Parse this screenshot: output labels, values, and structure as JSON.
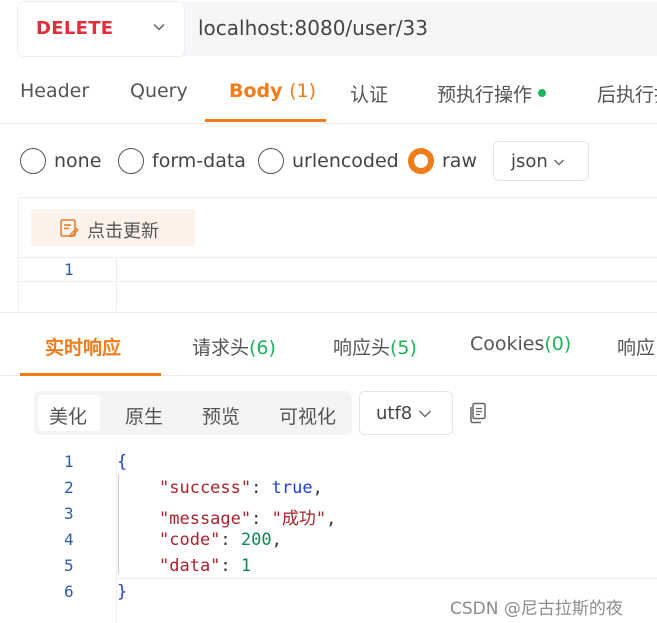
{
  "request": {
    "method": "DELETE",
    "url": "localhost:8080/user/33"
  },
  "request_tabs": [
    {
      "label": "Header",
      "count": ""
    },
    {
      "label": "Query",
      "count": ""
    },
    {
      "label": "Body",
      "count": "(1)"
    },
    {
      "label": "认证",
      "count": ""
    },
    {
      "label": "预执行操作",
      "count": ""
    },
    {
      "label": "后执行操",
      "count": ""
    }
  ],
  "body_types": [
    "none",
    "form-data",
    "urlencoded",
    "raw"
  ],
  "body_type_selected": "raw",
  "body_format": "json",
  "update_button": "点击更新",
  "request_editor": {
    "line_numbers": [
      "1"
    ]
  },
  "response_tabs": [
    {
      "label": "实时响应",
      "count": ""
    },
    {
      "label": "请求头",
      "count": "(6)"
    },
    {
      "label": "响应头",
      "count": "(5)"
    },
    {
      "label": "Cookies",
      "count": "(0)"
    },
    {
      "label": "响应:",
      "count": ""
    }
  ],
  "view_modes": [
    "美化",
    "原生",
    "预览",
    "可视化"
  ],
  "view_mode_selected": "美化",
  "encoding": "utf8",
  "response_body": {
    "line_numbers": [
      "1",
      "2",
      "3",
      "4",
      "5",
      "6"
    ],
    "open_brace": "{",
    "close_brace": "}",
    "fields": [
      {
        "key": "\"success\"",
        "value": "true",
        "kind": "keyword",
        "comma": ","
      },
      {
        "key": "\"message\"",
        "value": "\"成功\"",
        "kind": "string",
        "comma": ","
      },
      {
        "key": "\"code\"",
        "value": "200",
        "kind": "number",
        "comma": ","
      },
      {
        "key": "\"data\"",
        "value": "1",
        "kind": "number",
        "comma": ""
      }
    ]
  },
  "watermark": "CSDN @尼古拉斯的夜",
  "colors": {
    "accent": "#f07c1a",
    "method": "#e02e3a",
    "green": "#21b05b"
  }
}
